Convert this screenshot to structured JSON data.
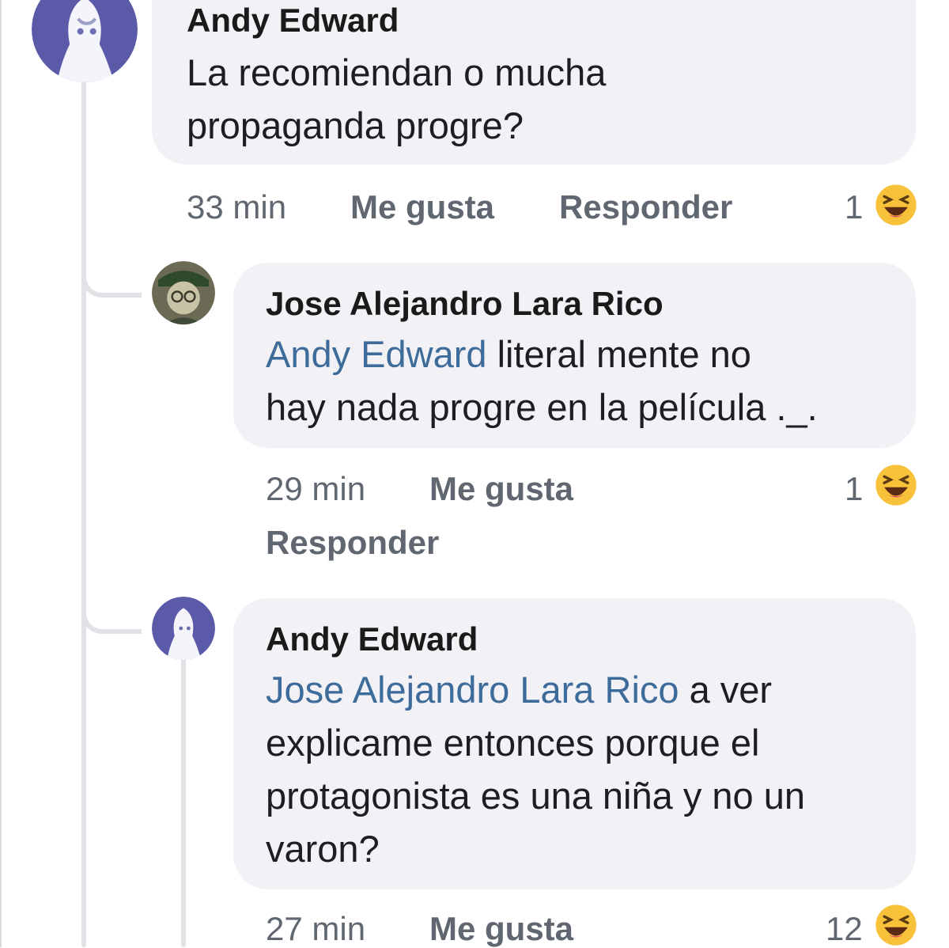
{
  "comments": [
    {
      "author": "Andy Edward",
      "text_lines": [
        "La recomiendan o mucha",
        "propaganda progre?"
      ],
      "time": "33 min",
      "like_label": "Me gusta",
      "reply_label": "Responder",
      "reaction_count": "1",
      "reaction_icon": "haha-emoji-icon"
    },
    {
      "author": "Jose Alejandro Lara Rico",
      "mention": "Andy Edward",
      "text_line1_rest": " literal mente no",
      "text_line2": "hay nada progre en la película ._.",
      "time": "29 min",
      "like_label": "Me gusta",
      "reply_label": "Responder",
      "reaction_count": "1",
      "reaction_icon": "haha-emoji-icon"
    },
    {
      "author": "Andy Edward",
      "mention": "Jose Alejandro Lara Rico",
      "text_line1_rest": " a ver",
      "text_line2": "explicame entonces porque el",
      "text_line3": "protagonista es una niña y no un",
      "text_line4": "varon?",
      "time": "27 min",
      "like_label": "Me gusta",
      "reaction_count": "12",
      "reaction_icon": "haha-emoji-icon"
    }
  ],
  "colors": {
    "bubble": "#f2f1f6",
    "mention": "#3d6b9a",
    "meta": "#606770",
    "thread_line": "#e1e1e6"
  }
}
